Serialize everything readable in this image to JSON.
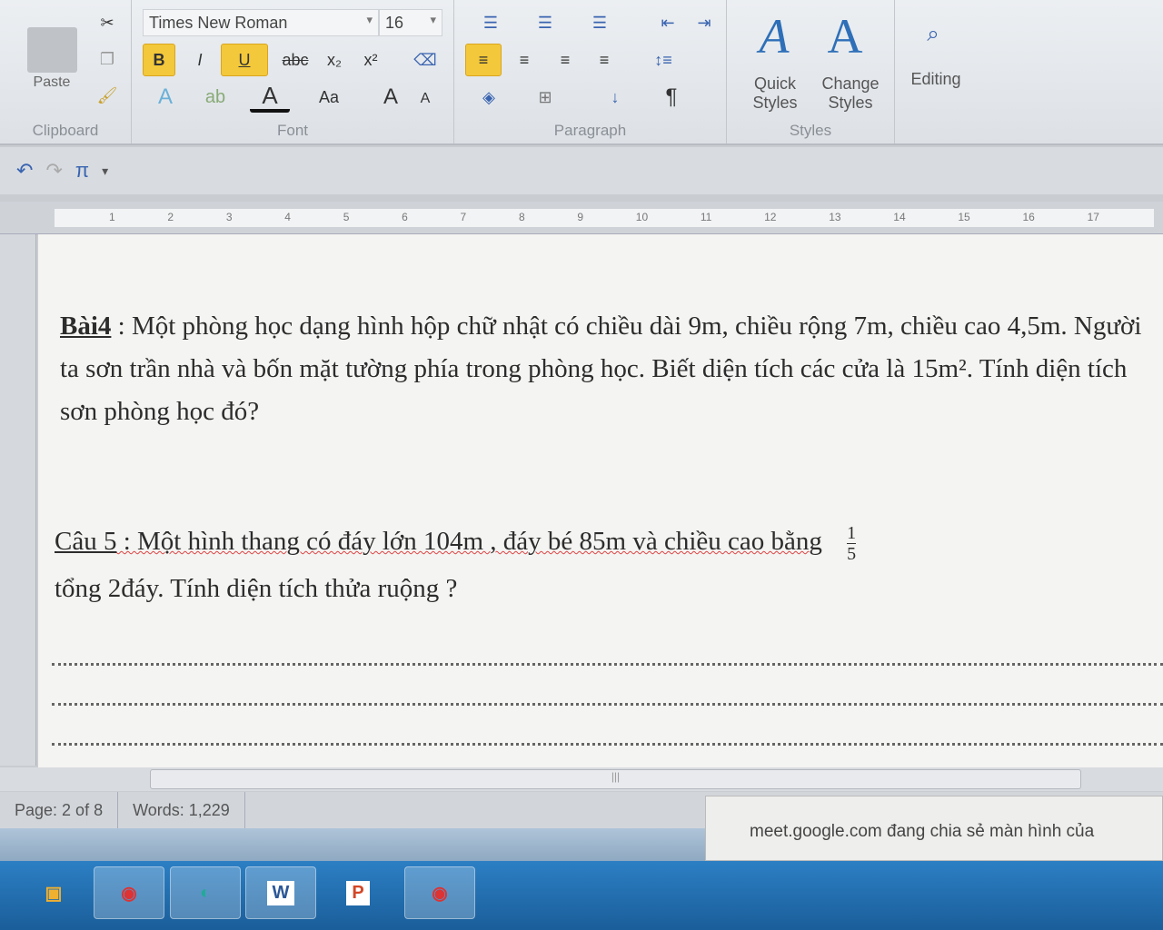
{
  "ribbon": {
    "font_name": "Times New Roman",
    "font_size": "16",
    "paste_label": "Paste",
    "groups": {
      "clipboard": "Clipboard",
      "font": "Font",
      "paragraph": "Paragraph",
      "styles": "Styles"
    },
    "quick_styles": "Quick Styles",
    "change_styles": "Change Styles",
    "editing": "Editing",
    "bold": "B",
    "italic": "I",
    "underline": "U",
    "strike": "abc",
    "subscript": "x₂",
    "superscript": "x²",
    "change_case": "Aa",
    "grow": "A",
    "shrink": "A",
    "pilcrow": "¶"
  },
  "qat": {
    "undo": "↶",
    "pi": "π",
    "more": "▾"
  },
  "ruler": {
    "ticks": [
      "1",
      "2",
      "3",
      "4",
      "5",
      "6",
      "7",
      "8",
      "9",
      "10",
      "11",
      "12",
      "13",
      "14",
      "15",
      "16",
      "17"
    ]
  },
  "document": {
    "p1_label": "Bài4",
    "p1_text": " : Một phòng học dạng hình hộp chữ nhật có chiều dài 9m, chiều rộng 7m, chiều cao 4,5m. Người ta sơn trần nhà và bốn mặt tường phía trong phòng học. Biết diện tích các cửa là 15m². Tính diện tích sơn phòng học đó?",
    "p2_label": "Câu 5",
    "p2_text_a": " : Một hình thang có đáy lớn 104m ,  đáy bé 85m và chiều cao bằng",
    "frac_num": "1",
    "frac_den": "5",
    "p2_text_b": "tổng 2đáy. Tính diện tích thửa ruộng ?"
  },
  "status": {
    "page": "Page: 2 of 8",
    "words": "Words: 1,229"
  },
  "notification": {
    "text": "meet.google.com đang chia sẻ màn hình của"
  },
  "taskbar": {
    "word": "W",
    "powerpoint": "P"
  },
  "colors": {
    "highlight": "#f3c83a",
    "taskbar": "#2c7fc4"
  }
}
